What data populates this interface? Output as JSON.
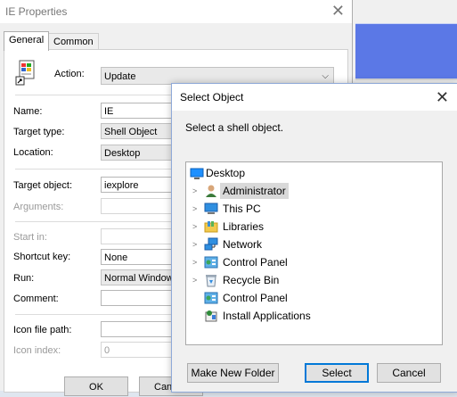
{
  "props": {
    "title": "IE Properties",
    "tabs": [
      "General",
      "Common"
    ],
    "action_label": "Action:",
    "action_value": "Update",
    "name_label": "Name:",
    "name_value": "IE",
    "target_type_label": "Target type:",
    "target_type_value": "Shell Object",
    "location_label": "Location:",
    "location_value": "Desktop",
    "target_object_label": "Target object:",
    "target_object_value": "iexplore",
    "arguments_label": "Arguments:",
    "start_in_label": "Start in:",
    "shortcut_key_label": "Shortcut key:",
    "shortcut_key_value": "None",
    "run_label": "Run:",
    "run_value": "Normal Window",
    "comment_label": "Comment:",
    "icon_file_path_label": "Icon file path:",
    "icon_index_label": "Icon index:",
    "icon_index_value": "0",
    "ok_label": "OK",
    "cancel_label": "Canc"
  },
  "dialog": {
    "title": "Select Object",
    "prompt": "Select a shell object.",
    "tree": {
      "root": {
        "label": "Desktop",
        "icon": "desktop-icon"
      },
      "items": [
        {
          "label": "Administrator",
          "icon": "user-icon",
          "expandable": true,
          "selected": true
        },
        {
          "label": "This PC",
          "icon": "computer-icon",
          "expandable": true,
          "selected": false
        },
        {
          "label": "Libraries",
          "icon": "libraries-icon",
          "expandable": true,
          "selected": false
        },
        {
          "label": "Network",
          "icon": "network-icon",
          "expandable": true,
          "selected": false
        },
        {
          "label": "Control Panel",
          "icon": "control-panel-icon",
          "expandable": true,
          "selected": false
        },
        {
          "label": "Recycle Bin",
          "icon": "recycle-bin-icon",
          "expandable": true,
          "selected": false
        },
        {
          "label": "Control Panel",
          "icon": "control-panel-icon",
          "expandable": false,
          "selected": false
        },
        {
          "label": "Install Applications",
          "icon": "install-applications-icon",
          "expandable": false,
          "selected": false
        }
      ]
    },
    "make_new_folder_label": "Make New Folder",
    "select_label": "Select",
    "cancel_label": "Cancel"
  },
  "colors": {
    "accent": "#0078d7",
    "background_window": "#5b78e6",
    "selection": "#d9d9d9"
  }
}
